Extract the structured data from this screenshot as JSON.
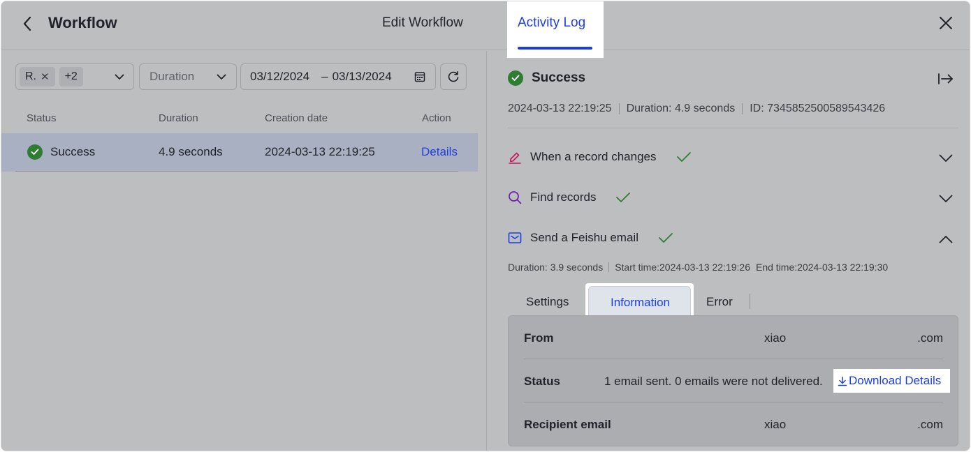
{
  "header": {
    "title": "Workflow",
    "edit_tab": "Edit Workflow",
    "active_tab": "Activity Log"
  },
  "filters": {
    "chip_label": "R.",
    "chip_extra": "+2",
    "duration_placeholder": "Duration",
    "date_start": "03/12/2024",
    "date_dash": "–",
    "date_end": "03/13/2024"
  },
  "table": {
    "columns": [
      "Status",
      "Duration",
      "Creation date",
      "Action"
    ],
    "rows": [
      {
        "status": "Success",
        "duration": "4.9 seconds",
        "created": "2024-03-13 22:19:25",
        "action": "Details"
      }
    ]
  },
  "detail": {
    "status": "Success",
    "timestamp": "2024-03-13 22:19:25",
    "duration": "Duration: 4.9 seconds",
    "id": "ID: 7345852500589543426",
    "steps": [
      {
        "label": "When a record changes"
      },
      {
        "label": "Find records"
      },
      {
        "label": "Send a Feishu email"
      }
    ],
    "step_meta": {
      "duration": "Duration: 3.9 seconds",
      "start": "Start time:2024-03-13 22:19:26",
      "end": "End time:2024-03-13 22:19:30"
    },
    "tabs": [
      "Settings",
      "Information",
      "Error"
    ],
    "info": {
      "from_key": "From",
      "from_user": "xiao",
      "from_domain": ".com",
      "status_key": "Status",
      "status_val": "1 email sent. 0 emails were not delivered.",
      "download": "Download Details",
      "recipient_key": "Recipient email",
      "recipient_user": "xiao",
      "recipient_domain": ".com"
    }
  },
  "colors": {
    "accent": "#1d3fe0",
    "success": "#2e7d32",
    "trigger_icon": "#c2185b",
    "find_icon": "#6a1bb0",
    "email_icon": "#1d3fe0"
  }
}
